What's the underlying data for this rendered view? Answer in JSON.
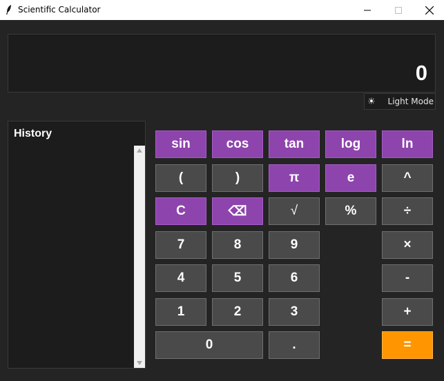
{
  "window": {
    "title": "Scientific Calculator",
    "icon": "feather-icon"
  },
  "display": {
    "value": "0"
  },
  "theme_toggle": {
    "icon": "sun-icon",
    "label": "Light Mode"
  },
  "history": {
    "title": "History",
    "entries": []
  },
  "colors": {
    "function_key": "#8e44ad",
    "number_key": "#4a4a4a",
    "equals_key": "#ff9500",
    "background": "#242424"
  },
  "keys": {
    "sin": "sin",
    "cos": "cos",
    "tan": "tan",
    "log": "log",
    "ln": "ln",
    "lparen": "(",
    "rparen": ")",
    "pi": "π",
    "e": "e",
    "power": "^",
    "clear": "C",
    "backspace": "⌫",
    "sqrt": "√",
    "percent": "%",
    "divide": "÷",
    "seven": "7",
    "eight": "8",
    "nine": "9",
    "multiply": "×",
    "four": "4",
    "five": "5",
    "six": "6",
    "subtract": "-",
    "one": "1",
    "two": "2",
    "three": "3",
    "add": "+",
    "zero": "0",
    "decimal": ".",
    "equals": "="
  }
}
